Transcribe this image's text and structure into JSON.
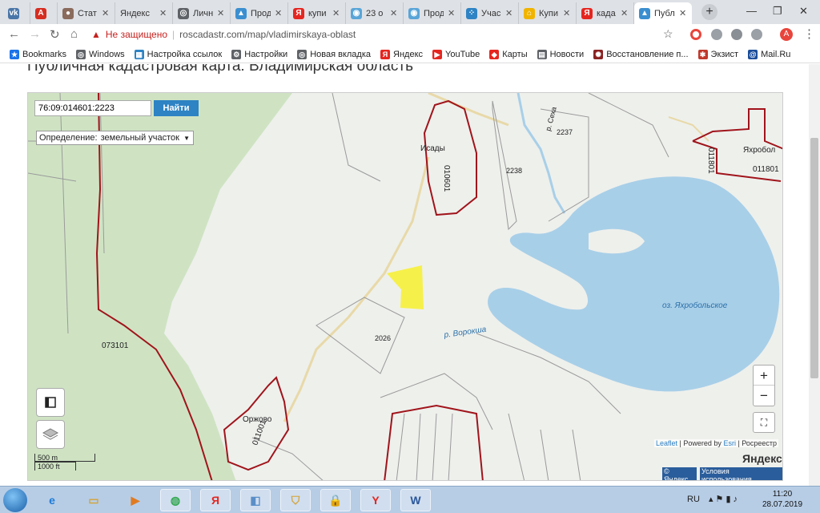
{
  "tabs": [
    {
      "title": "",
      "icon": "vk-icon",
      "color": "#4a76a8",
      "glyph": "vk"
    },
    {
      "title": "",
      "icon": "a-icon",
      "color": "#d62d20",
      "glyph": "A"
    },
    {
      "title": "Стат",
      "icon": "avatar-icon",
      "color": "#8a6b5c",
      "glyph": "●"
    },
    {
      "title": "Яндекс",
      "icon": "",
      "color": "",
      "glyph": ""
    },
    {
      "title": "Личн",
      "icon": "globe-icon",
      "color": "#5f6368",
      "glyph": "◎"
    },
    {
      "title": "Прод",
      "icon": "domclick-icon",
      "color": "#3b8fd0",
      "glyph": "▲"
    },
    {
      "title": "купи",
      "icon": "yandex-icon",
      "color": "#e52620",
      "glyph": "Я"
    },
    {
      "title": "23 о",
      "icon": "location-icon",
      "color": "#59a5d8",
      "glyph": "◉"
    },
    {
      "title": "Прод",
      "icon": "location-icon",
      "color": "#59a5d8",
      "glyph": "◉"
    },
    {
      "title": "Учас",
      "icon": "dots-icon",
      "color": "#2d83c4",
      "glyph": "⁘"
    },
    {
      "title": "Купи",
      "icon": "house-icon",
      "color": "#f0b400",
      "glyph": "⌂"
    },
    {
      "title": "када",
      "icon": "yandex-icon",
      "color": "#e52620",
      "glyph": "Я"
    },
    {
      "title": "Публ",
      "icon": "domclick-icon",
      "color": "#3b8fd0",
      "glyph": "▲"
    }
  ],
  "toolbar": {
    "insecure_label": "Не защищено",
    "url": "roscadastr.com/map/vladimirskaya-oblast",
    "profile_letter": "A"
  },
  "bookmarks": [
    {
      "label": "Bookmarks",
      "icon": "star-icon",
      "color": "#1a73e8",
      "glyph": "★"
    },
    {
      "label": "Windows",
      "icon": "globe-icon",
      "color": "#5f6368",
      "glyph": "◎"
    },
    {
      "label": "Настройка ссылок",
      "icon": "windows-icon",
      "color": "#2d83c4",
      "glyph": "▦"
    },
    {
      "label": "Настройки",
      "icon": "gear-icon",
      "color": "#5f6368",
      "glyph": "⚙"
    },
    {
      "label": "Новая вкладка",
      "icon": "globe-icon",
      "color": "#5f6368",
      "glyph": "◎"
    },
    {
      "label": "Яндекс",
      "icon": "yandex-icon",
      "color": "#e52620",
      "glyph": "Я"
    },
    {
      "label": "YouTube",
      "icon": "youtube-icon",
      "color": "#e52620",
      "glyph": "▶"
    },
    {
      "label": "Карты",
      "icon": "maps-icon",
      "color": "#e52620",
      "glyph": "◆"
    },
    {
      "label": "Новости",
      "icon": "news-icon",
      "color": "#5f6368",
      "glyph": "▤"
    },
    {
      "label": "Восстановление п...",
      "icon": "restore-icon",
      "color": "#8b2222",
      "glyph": "✺"
    },
    {
      "label": "Экзист",
      "icon": "exist-icon",
      "color": "#c0392b",
      "glyph": "✱"
    },
    {
      "label": "Mail.Ru",
      "icon": "mailru-icon",
      "color": "#1c4e9a",
      "glyph": "@"
    }
  ],
  "page": {
    "title": "Публичная кадастровая карта: Владимирская область"
  },
  "map": {
    "search_value": "76:09:014601:2223",
    "find_label": "Найти",
    "definition_label": "Определение:",
    "definition_value": "земельный участок",
    "zoom_in": "+",
    "zoom_out": "−",
    "scale_m": "500 m",
    "scale_ft": "1000 ft",
    "attrib_leaflet": "Leaflet",
    "attrib_powered": "| Powered by",
    "attrib_esri": "Esri",
    "attrib_rosreestr": "| Росреестр",
    "yandex_logo": "Яндекс",
    "yandex_copy": "© Яндекс",
    "yandex_terms": "Условия использования",
    "labels": {
      "isady": "Исады",
      "q010601": "010601",
      "p2237": "2237",
      "p2238": "2238",
      "river_sekha": "р. Сеха",
      "yakhrobol": "Яхробол",
      "q011801a": "011801",
      "q011801b": "011801",
      "q073101": "073101",
      "p2026": "2026",
      "river_vorokshi": "р. Ворокша",
      "lake": "оз. Яхробольское",
      "orzhovo": "Оржово",
      "q011001": "011001"
    },
    "colors": {
      "water": "#a8cfe8",
      "forest": "#cfe3c3",
      "parcel_border": "#a0141b",
      "highlight": "#f6f04a",
      "road": "#e8d9a8"
    }
  },
  "taskbar": {
    "apps": [
      {
        "icon": "ie-icon",
        "glyph": "e",
        "color": "#1e7bd6"
      },
      {
        "icon": "explorer-icon",
        "glyph": "▭",
        "color": "#d4a437"
      },
      {
        "icon": "media-player-icon",
        "glyph": "▶",
        "color": "#e07b22"
      },
      {
        "icon": "chrome-icon",
        "glyph": "◍",
        "color": "#34a853"
      },
      {
        "icon": "yandex-icon",
        "glyph": "Я",
        "color": "#e52620"
      },
      {
        "icon": "window-icon",
        "glyph": "◧",
        "color": "#5a8fc8"
      },
      {
        "icon": "shield-icon",
        "glyph": "⛉",
        "color": "#d4a437"
      },
      {
        "icon": "lock-icon",
        "glyph": "🔒",
        "color": "#333333"
      },
      {
        "icon": "yandex-browser-icon",
        "glyph": "Y",
        "color": "#e52620"
      },
      {
        "icon": "word-icon",
        "glyph": "W",
        "color": "#2b579a"
      }
    ],
    "lang": "RU",
    "time": "11:20",
    "date": "28.07.2019"
  }
}
